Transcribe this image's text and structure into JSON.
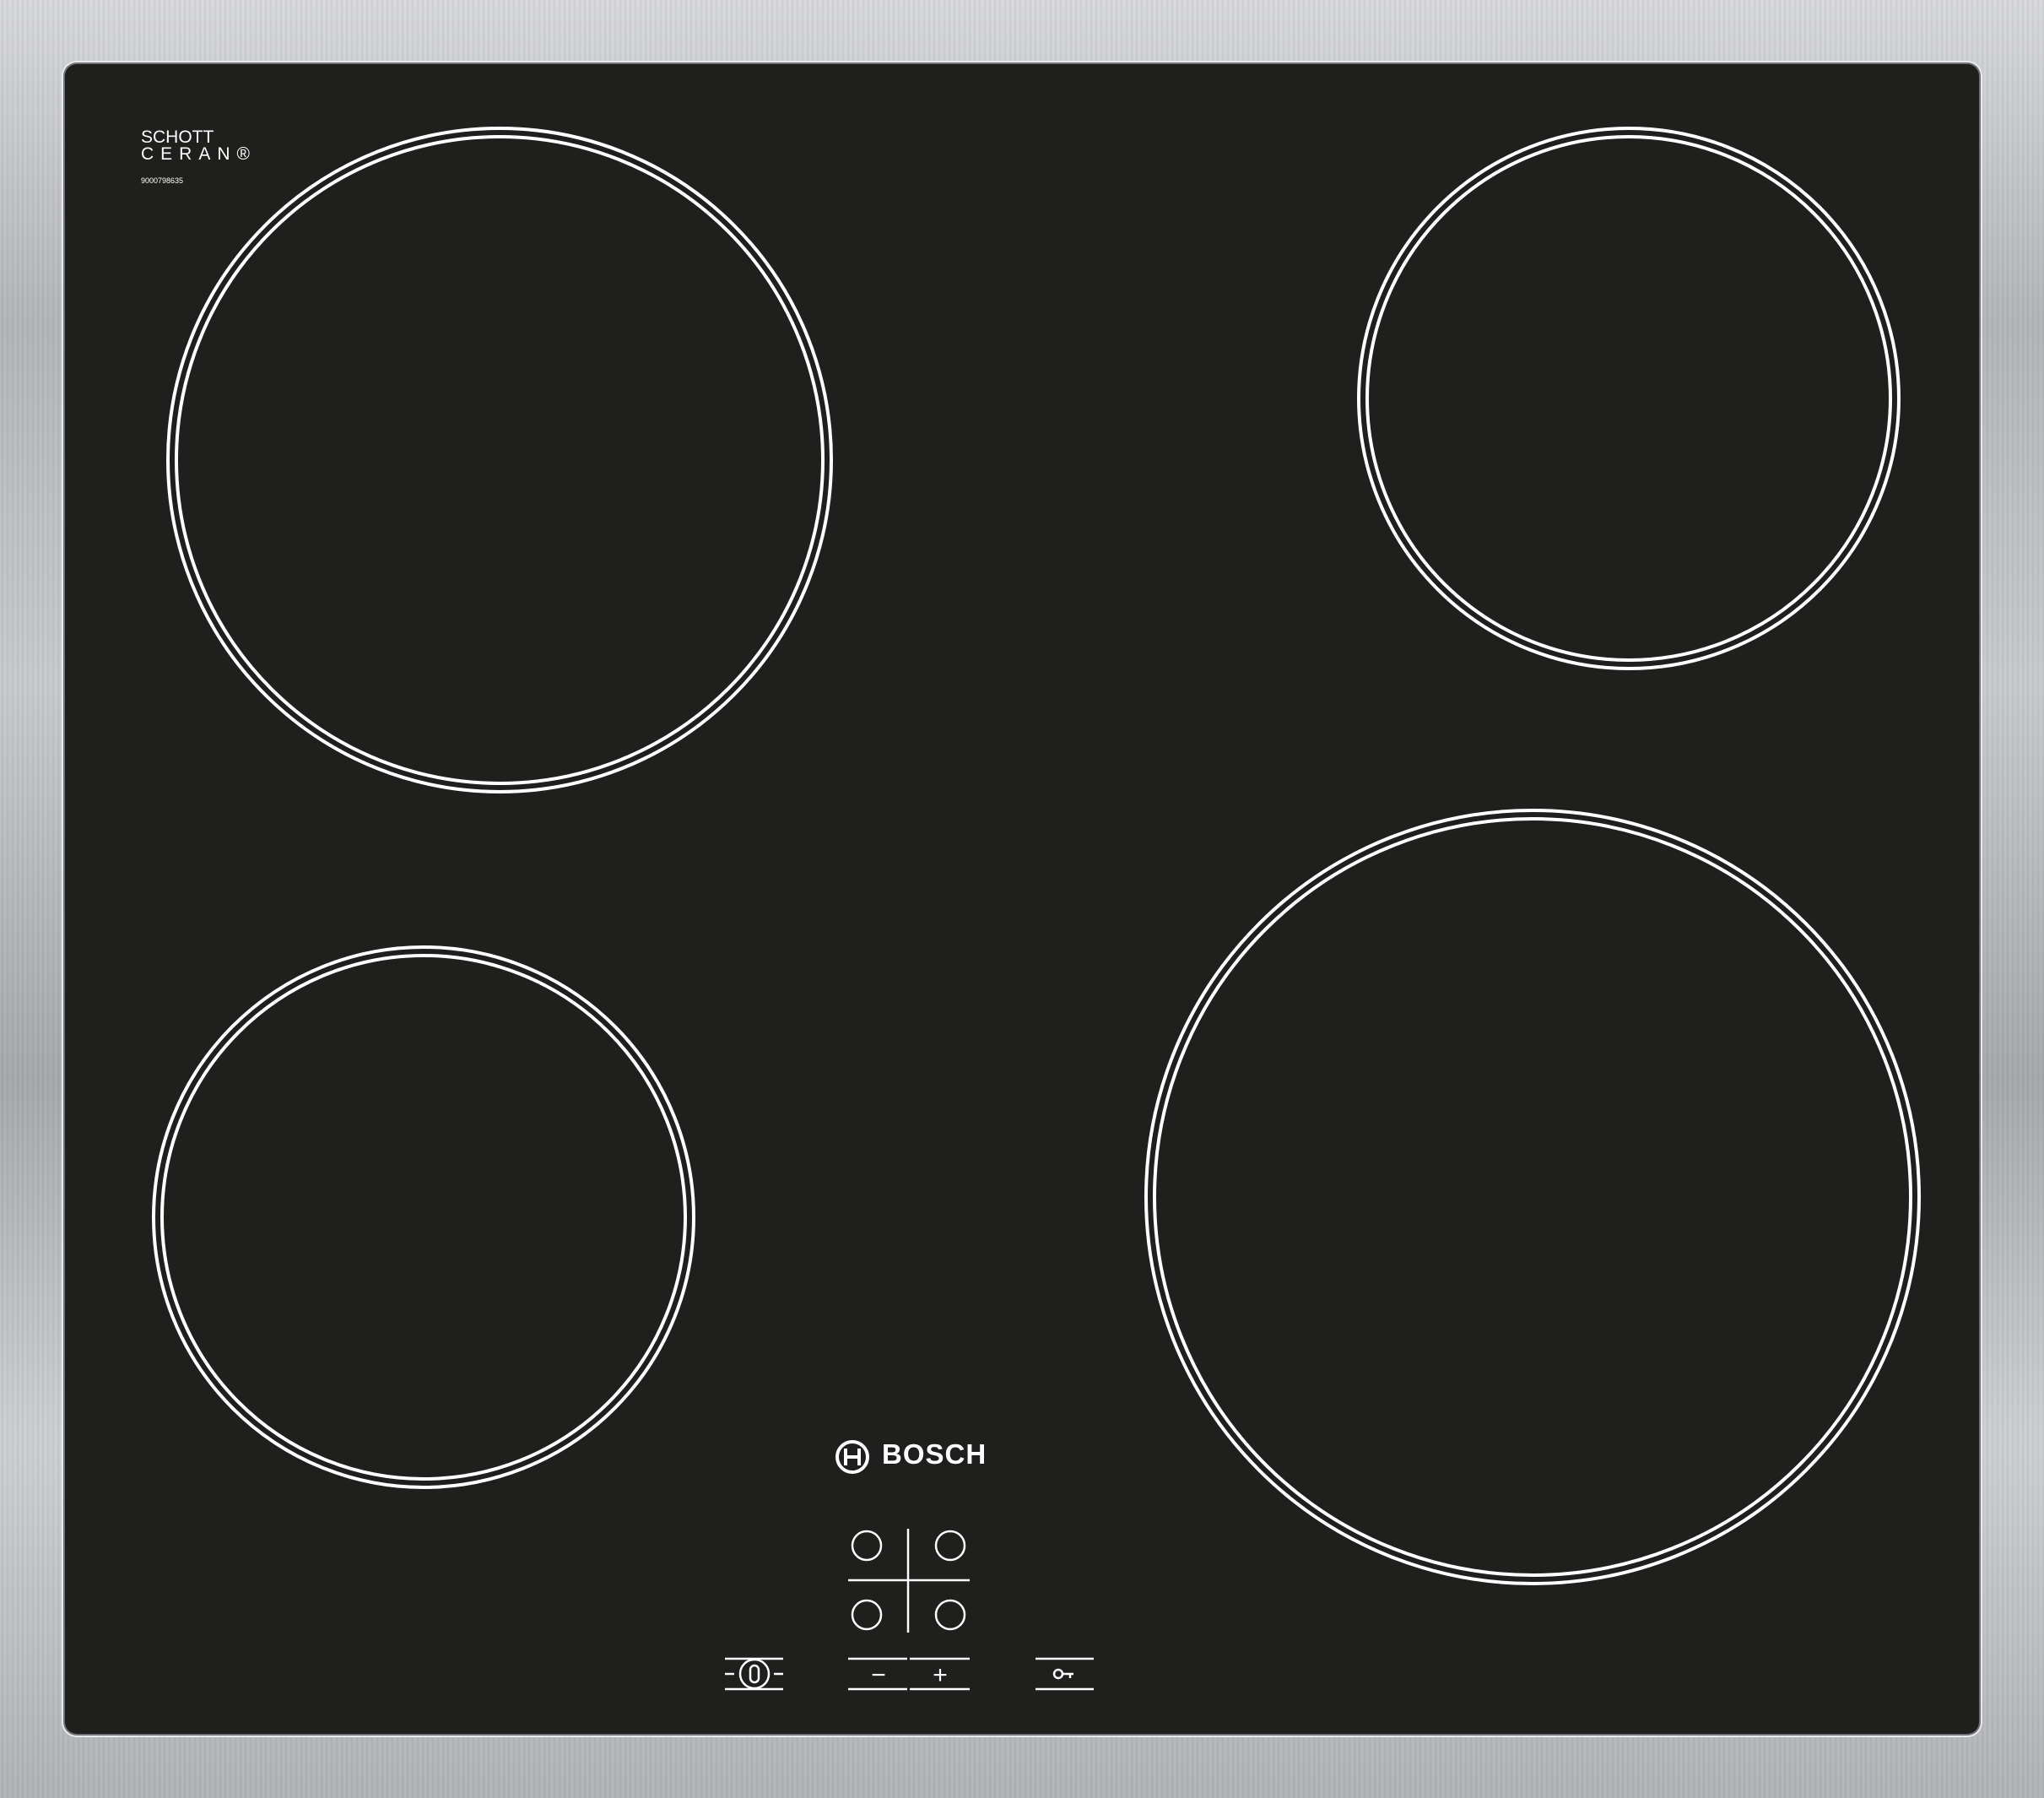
{
  "glass_logo": {
    "line1": "SCHOTT",
    "line2": "CERAN",
    "registered": "®",
    "serial": "9000798635"
  },
  "brand": {
    "name": "BOSCH",
    "icon": "bosch-logo-icon"
  },
  "controls": {
    "minus": "−",
    "plus": "+",
    "power_icon": "power-icon",
    "lock_icon": "key-lock-icon"
  },
  "colors": {
    "glass": "#1f1f1d",
    "frame": "#bfc1c4",
    "markings": "#ffffff"
  }
}
